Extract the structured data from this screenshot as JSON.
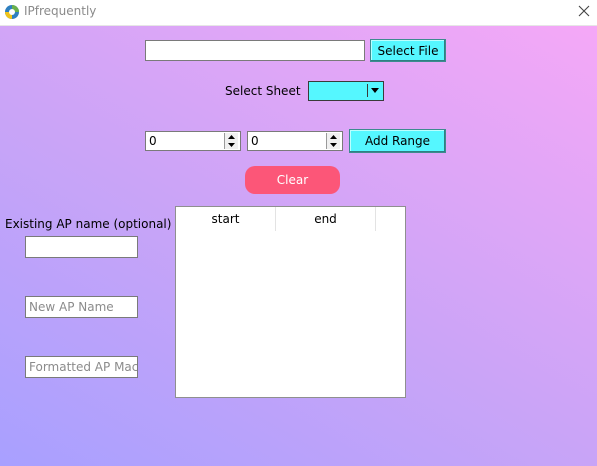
{
  "window": {
    "title": "IPfrequently",
    "icons": {
      "app": "app-logo-icon",
      "close": "close-icon"
    }
  },
  "file": {
    "path_value": "",
    "select_button": "Select File"
  },
  "sheet": {
    "label": "Select Sheet",
    "selected": ""
  },
  "range": {
    "start_value": "0",
    "end_value": "0",
    "add_button": "Add Range"
  },
  "clear_button": "Clear",
  "ap": {
    "existing_label": "Existing AP name (optional)",
    "existing_value": "",
    "new_name_placeholder": "New AP Name",
    "mac_placeholder": "Formatted AP Mac"
  },
  "table": {
    "columns": [
      "start",
      "end"
    ],
    "rows": []
  },
  "colors": {
    "button_cyan": "#55f7ff",
    "clear_pink": "#fc5678",
    "gradient": [
      "#a8a0ff",
      "#f5a8f7"
    ]
  }
}
